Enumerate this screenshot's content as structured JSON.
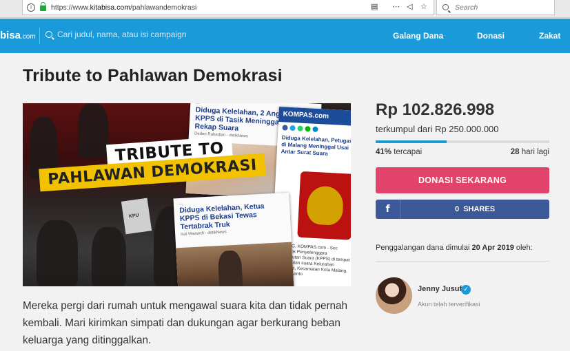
{
  "browser": {
    "url_prefix": "https://www.",
    "url_domain": "kitabisa.com",
    "url_path": "/pahlawandemokrasi",
    "search_placeholder": "Search"
  },
  "nav": {
    "logo_main": "bisa",
    "logo_suffix": ".com",
    "search_placeholder": "Cari judul, nama, atau isi campaign",
    "links": [
      "Galang Dana",
      "Donasi",
      "Zakat"
    ]
  },
  "campaign": {
    "title": "Tribute to Pahlawan Demokrasi",
    "hero": {
      "banner_line1": "TRIBUTE TO",
      "banner_line2": "PAHLAWAN DEMOKRASI",
      "box_label": "KPU",
      "clip1_headline": "Diduga Kelelahan, 2 Anggota KPPS di Tasik Meninggal saat Rekap Suara",
      "clip1_byline": "Deden Rahadian - detikNews",
      "clip2_brand": "KOMPAS.com",
      "clip2_headline": "Diduga Kelelahan, Petugas di Malang Meninggal Usai Antar Surat Suara",
      "clip2_text": "MALANG, KOMPAS.com - Sec Kelompok Penyelenggara Pemungutan Suara (KPPS) di tempat pemungutan suara Kelurahan Tlogomas, Kecamatan Kota Malang, Agus Susanto",
      "clip3_headline": "Diduga Kelelahan, Ketua KPPS di Bekasi Tewas Tertabrak Truk",
      "clip3_byline": "Isal Mawardi - detikNews"
    },
    "description": "Mereka pergi dari rumah untuk mengawal suara kita dan tidak pernah kembali. Mari kirimkan simpati dan dukungan agar berkurang beban keluarga yang ditinggalkan.",
    "amount": "Rp 102.826.998",
    "target": "terkumpul dari Rp 250.000.000",
    "progress_percent": 41,
    "percent_value": "41%",
    "percent_label": " tercapai",
    "days_value": "28",
    "days_label": " hari lagi",
    "donate_label": "DONASI SEKARANG",
    "share_count": "0",
    "share_label": "SHARES",
    "started_prefix": "Penggalangan dana dimulai ",
    "started_date": "20 Apr 2019",
    "started_suffix": " oleh:",
    "organizer_name": "Jenny Jusuf",
    "organizer_status": "Akun telah terverifikasi"
  },
  "colors": {
    "brand_blue": "#1a9ad8",
    "donate_pink": "#e1436b",
    "facebook_blue": "#3b5998"
  }
}
